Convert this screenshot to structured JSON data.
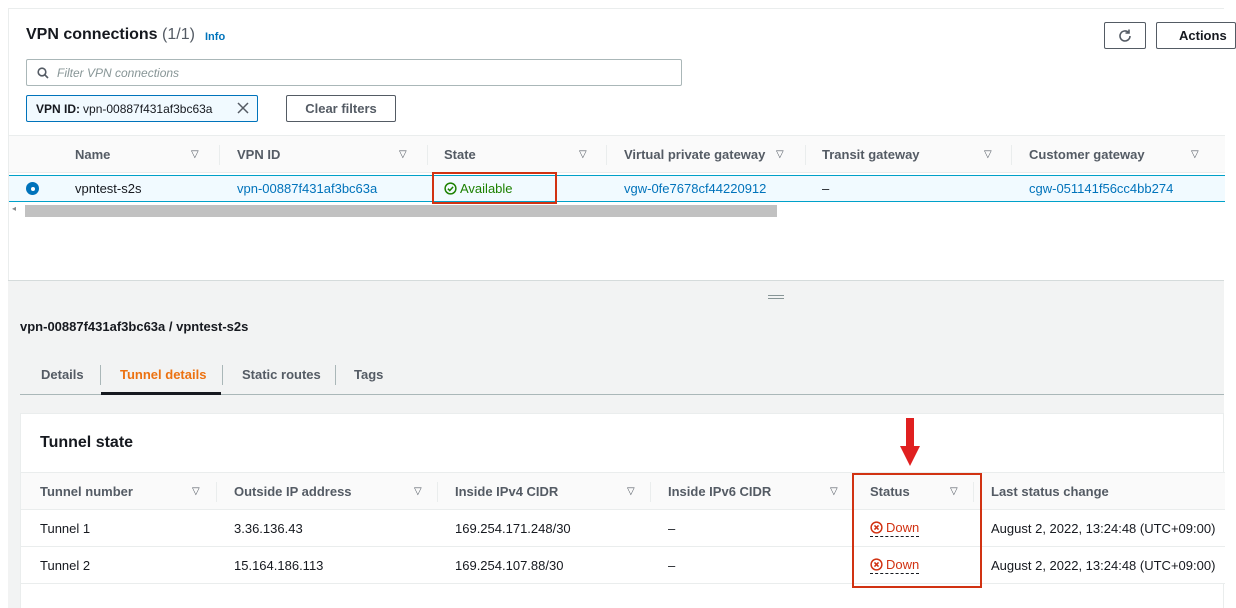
{
  "list": {
    "title": "VPN connections",
    "count": "(1/1)",
    "info": "Info",
    "actions_label": "Actions",
    "filter_placeholder": "Filter VPN connections",
    "token_key": "VPN ID:",
    "token_value": "vpn-00887f431af3bc63a",
    "clear_filters": "Clear filters",
    "columns": [
      "Name",
      "VPN ID",
      "State",
      "Virtual private gateway",
      "Transit gateway",
      "Customer gateway"
    ],
    "row": {
      "name": "vpntest-s2s",
      "vpn_id": "vpn-00887f431af3bc63a",
      "state": "Available",
      "vgw": "vgw-0fe7678cf44220912",
      "tgw": "–",
      "cgw": "cgw-051141f56cc4bb274"
    }
  },
  "details": {
    "title": "vpn-00887f431af3bc63a / vpntest-s2s",
    "tabs": [
      "Details",
      "Tunnel details",
      "Static routes",
      "Tags"
    ],
    "active_tab": "Tunnel details",
    "card_title": "Tunnel state",
    "columns": [
      "Tunnel number",
      "Outside IP address",
      "Inside IPv4 CIDR",
      "Inside IPv6 CIDR",
      "Status",
      "Last status change"
    ],
    "rows": [
      {
        "tunnel": "Tunnel 1",
        "outside_ip": "3.36.136.43",
        "ipv4": "169.254.171.248/30",
        "ipv6": "–",
        "status": "Down",
        "last_change": "August 2, 2022, 13:24:48 (UTC+09:00)"
      },
      {
        "tunnel": "Tunnel 2",
        "outside_ip": "15.164.186.113",
        "ipv4": "169.254.107.88/30",
        "ipv6": "–",
        "status": "Down",
        "last_change": "August 2, 2022, 13:24:48 (UTC+09:00)"
      }
    ]
  },
  "colors": {
    "link": "#0073bb",
    "available": "#1d8102",
    "down": "#d13212",
    "highlight": "#d13212",
    "active_tab": "#ec7211"
  }
}
